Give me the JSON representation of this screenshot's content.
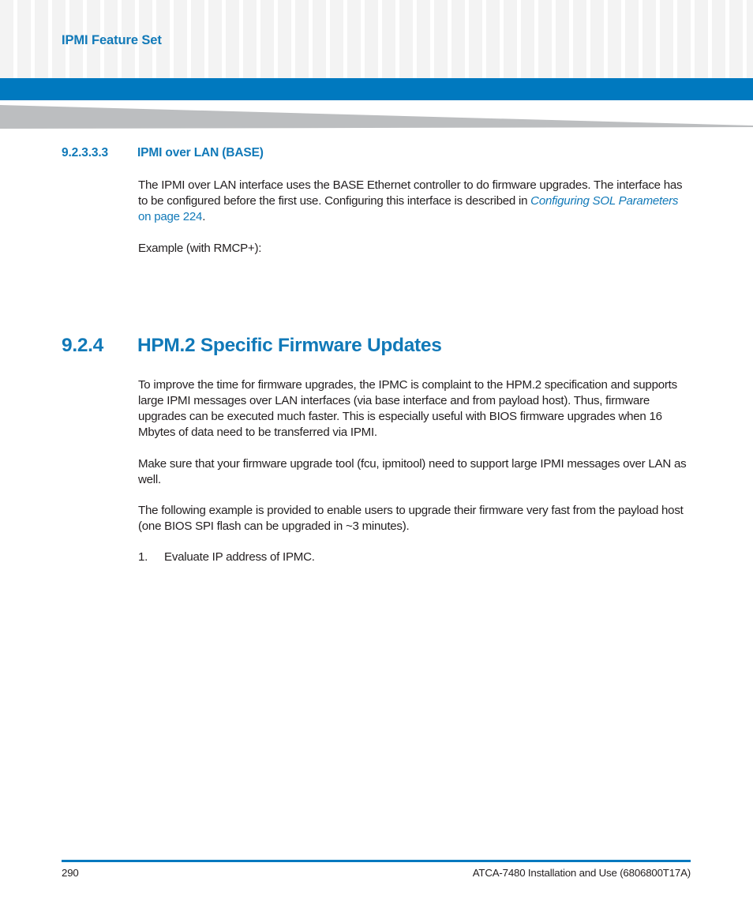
{
  "header": {
    "running_head": "IPMI Feature Set",
    "band_color": "#0079bf",
    "wedge_color": "#bcbec0",
    "accent_color": "#1179b8"
  },
  "sections": {
    "sub": {
      "number": "9.2.3.3.3",
      "title": "IPMI over LAN (BASE)",
      "paragraph_part1": "The IPMI over LAN interface uses the BASE Ethernet controller to do firmware upgrades. The interface has to be configured before the first use. Configuring this interface is described in ",
      "xref_title": "Configuring SOL Parameters",
      "xref_page": " on page 224",
      "paragraph_end": ".",
      "example": "Example (with RMCP+):"
    },
    "main": {
      "number": "9.2.4",
      "title": "HPM.2 Specific Firmware Updates",
      "paragraph1": "To improve the time for firmware upgrades, the IPMC is complaint to the HPM.2 specification and supports large IPMI messages over LAN interfaces (via base interface and from payload host). Thus, firmware upgrades can be executed much faster. This is especially useful with BIOS firmware upgrades when 16 Mbytes of data need to be transferred via IPMI.",
      "paragraph2": "Make sure that your firmware upgrade tool (fcu, ipmitool) need to support large IPMI messages over LAN as well.",
      "paragraph3": "The following example is provided to enable users to upgrade their firmware very fast from the payload host (one BIOS SPI flash can be upgraded in ~3 minutes).",
      "steps": [
        {
          "marker": "1.",
          "text": "Evaluate IP address of IPMC."
        }
      ]
    }
  },
  "footer": {
    "page_number": "290",
    "document_title": "ATCA-7480 Installation and Use (6806800T17A)"
  }
}
